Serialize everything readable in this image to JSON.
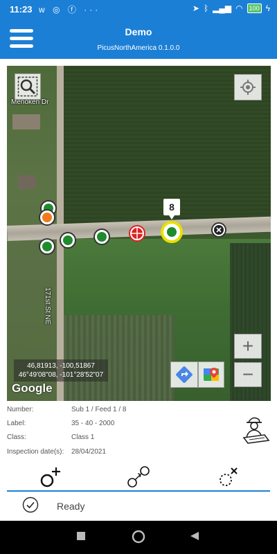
{
  "status_bar": {
    "time": "11:23",
    "left_icons": [
      "w-icon",
      "whatsapp-icon",
      "facebook-icon",
      "more-icon"
    ],
    "right_icons": [
      "location-icon",
      "bluetooth-icon",
      "signal-icon",
      "wifi-icon",
      "battery-icon"
    ],
    "battery": "100"
  },
  "header": {
    "title": "Demo",
    "subtitle": "PicusNorthAmerica 0.1.0.0"
  },
  "map": {
    "street_labels": [
      "Menoken Dr",
      "171st St NE"
    ],
    "coordinates_decimal": "46,81913, -100,51867",
    "coordinates_dms": "46°49'08\"08, -101°28'52\"07",
    "provider": "Google",
    "zoom_in": "+",
    "zoom_out": "−",
    "selected_label": "8"
  },
  "info": {
    "number_label": "Number:",
    "number_value": "Sub 1 / Feed 1 / 8",
    "label_label": "Label:",
    "label_value": "35 - 40 - 2000",
    "class_label": "Class:",
    "class_value": "Class 1",
    "inspection_label": "Inspection date(s):",
    "inspection_value": "28/04/2021"
  },
  "tools": [
    "add-point-icon",
    "move-point-icon",
    "delete-point-icon"
  ],
  "status": {
    "text": "Ready"
  },
  "colors": {
    "primary": "#1c7fd6",
    "pin_green": "#1f8a2e",
    "pin_orange": "#f07b1e",
    "pin_red": "#e02020",
    "pin_selected": "#e8e000"
  }
}
